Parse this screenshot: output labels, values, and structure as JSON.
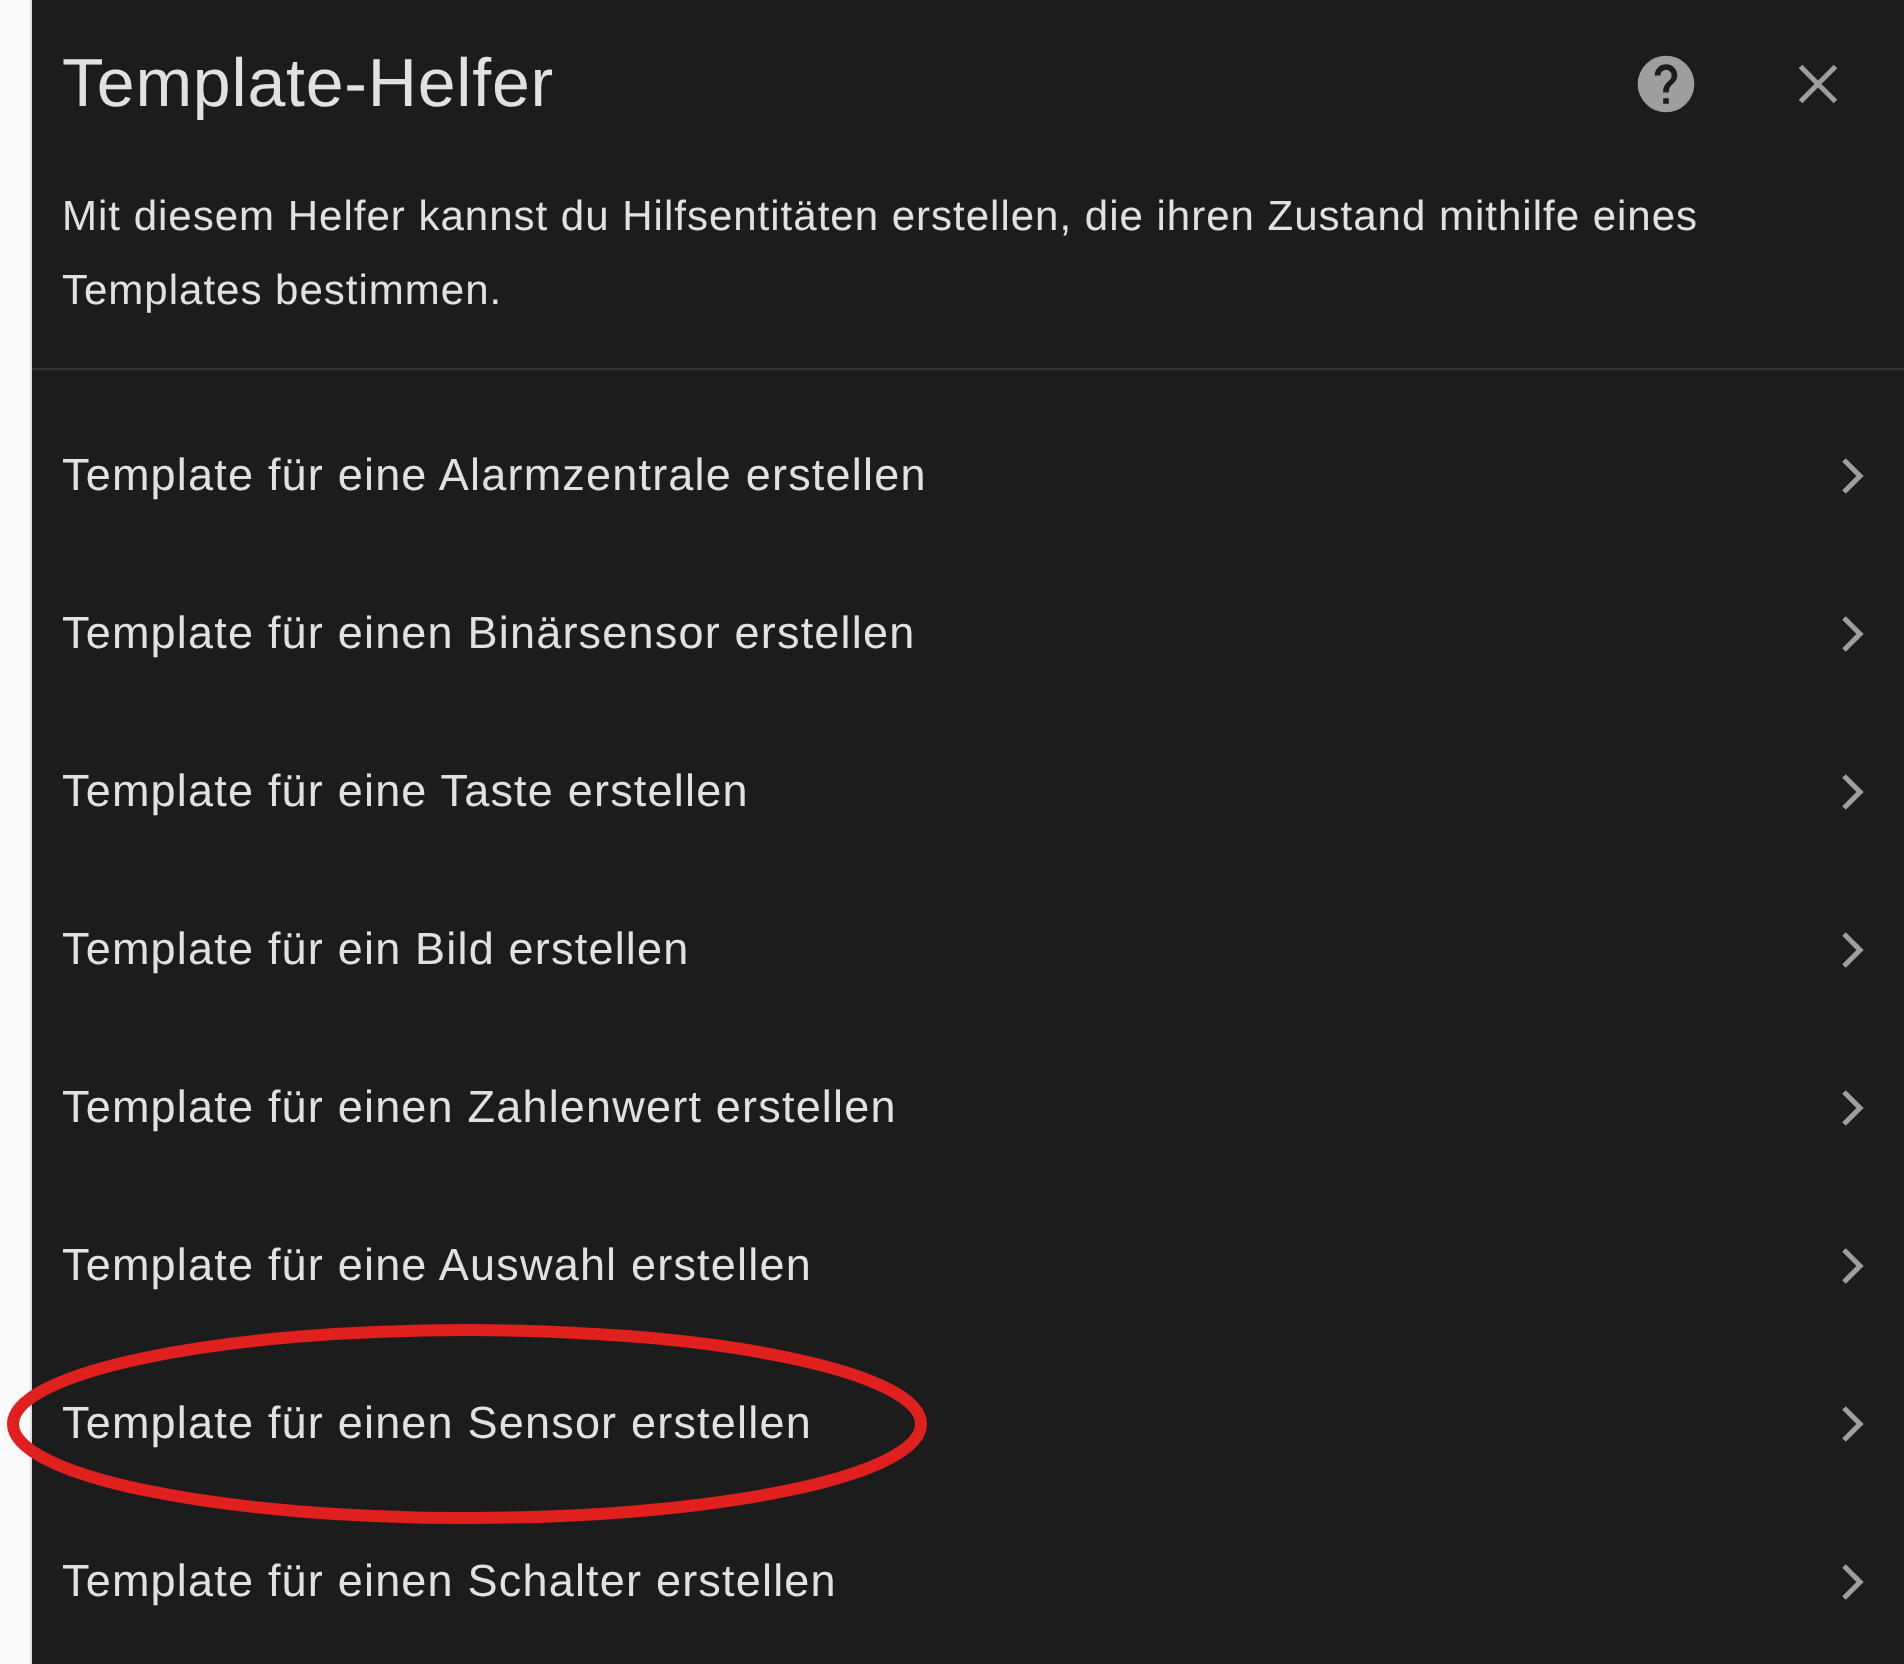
{
  "dialog": {
    "title": "Template-Helfer",
    "description": "Mit diesem Helfer kannst du Hilfsentitäten erstellen, die ihren Zustand mithilfe eines Templates bestimmen.",
    "items": [
      {
        "label": "Template für eine Alarmzentrale erstellen",
        "circled": false
      },
      {
        "label": "Template für einen Binärsensor erstellen",
        "circled": false
      },
      {
        "label": "Template für eine Taste erstellen",
        "circled": false
      },
      {
        "label": "Template für ein Bild erstellen",
        "circled": false
      },
      {
        "label": "Template für einen Zahlenwert erstellen",
        "circled": false
      },
      {
        "label": "Template für eine Auswahl erstellen",
        "circled": false
      },
      {
        "label": "Template für einen Sensor erstellen",
        "circled": true
      },
      {
        "label": "Template für einen Schalter erstellen",
        "circled": false
      }
    ]
  }
}
